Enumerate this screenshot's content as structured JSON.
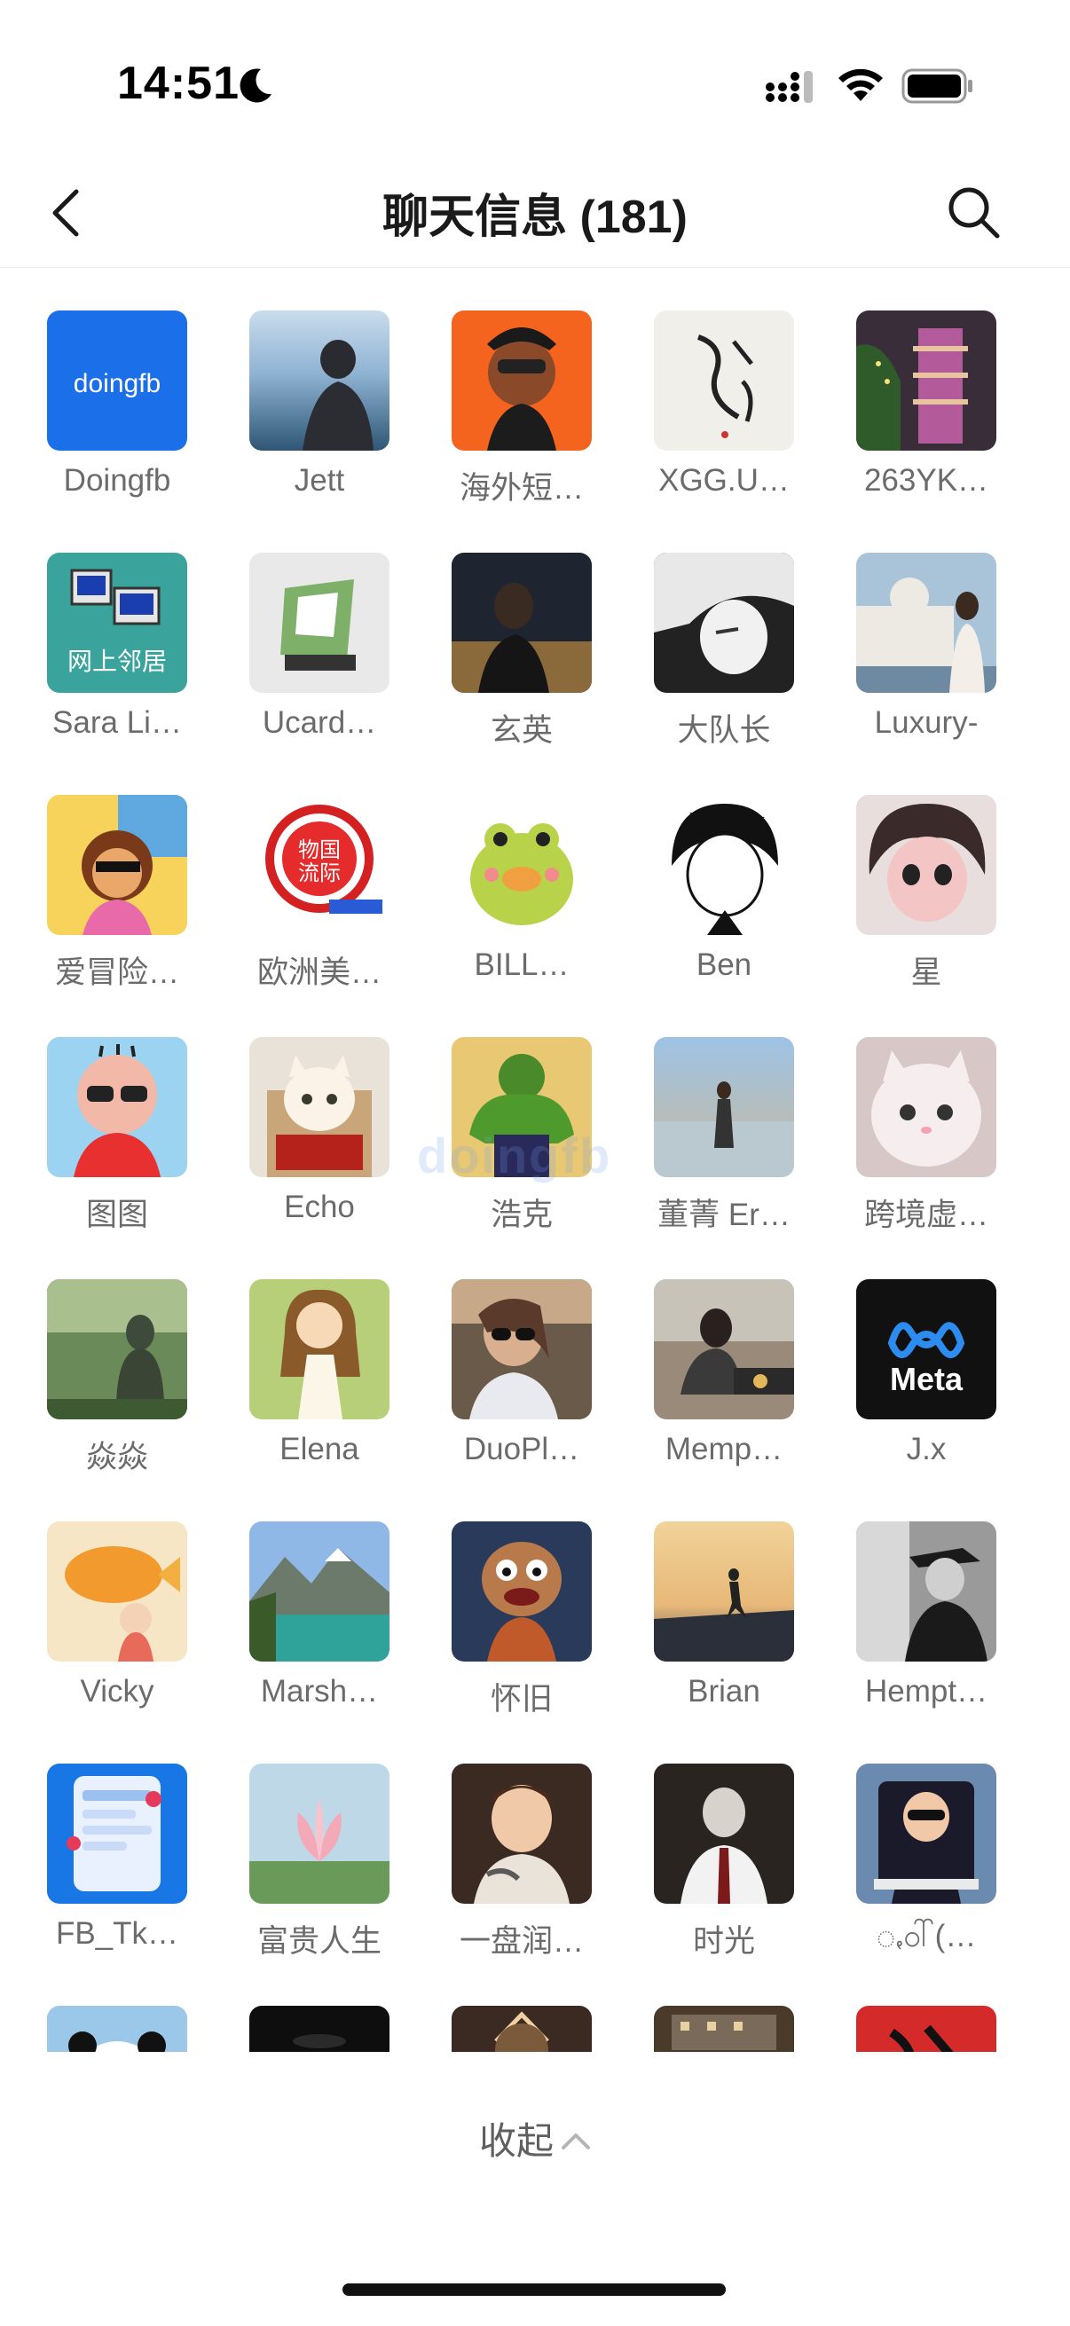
{
  "status_bar": {
    "time": "14:51"
  },
  "nav": {
    "title": "聊天信息 (181)"
  },
  "members": [
    {
      "name": "Doingfb",
      "avatar": "doingfb-logo"
    },
    {
      "name": "Jett",
      "avatar": "person-by-sea-photo"
    },
    {
      "name": "海外短…",
      "avatar": "cartoon-man-orange-photo"
    },
    {
      "name": "XGG.U…",
      "avatar": "calligraphy-photo"
    },
    {
      "name": "263YK…",
      "avatar": "pagoda-night-photo"
    },
    {
      "name": "Sara Li…",
      "avatar": "network-neighborhood-icon"
    },
    {
      "name": "Ucard…",
      "avatar": "ucard-logo"
    },
    {
      "name": "玄英",
      "avatar": "portrait-dark-photo"
    },
    {
      "name": "大队长",
      "avatar": "anime-boy-bw-photo"
    },
    {
      "name": "Luxury-",
      "avatar": "woman-palace-photo"
    },
    {
      "name": "爱冒险…",
      "avatar": "cartoon-girl-photo"
    },
    {
      "name": "欧洲美…",
      "avatar": "logistics-stamp-logo"
    },
    {
      "name": "BILL…",
      "avatar": "green-frog-photo"
    },
    {
      "name": "Ben",
      "avatar": "manga-boy-photo"
    },
    {
      "name": "星",
      "avatar": "anime-boy-pink-photo"
    },
    {
      "name": "图图",
      "avatar": "cartoon-boy-photo"
    },
    {
      "name": "Echo",
      "avatar": "cat-in-box-photo"
    },
    {
      "name": "浩克",
      "avatar": "hulk-photo"
    },
    {
      "name": "董菁 Er…",
      "avatar": "woman-beach-photo"
    },
    {
      "name": "跨境虚…",
      "avatar": "white-kitten-photo"
    },
    {
      "name": "焱焱",
      "avatar": "buddha-forest-photo"
    },
    {
      "name": "Elena",
      "avatar": "cartoon-girl-dress-photo"
    },
    {
      "name": "DuoPl…",
      "avatar": "woman-sunglasses-photo"
    },
    {
      "name": "Memp…",
      "avatar": "woman-cafe-photo"
    },
    {
      "name": "J.x",
      "avatar": "meta-logo"
    },
    {
      "name": "Vicky",
      "avatar": "girl-goldfish-photo"
    },
    {
      "name": "Marsh…",
      "avatar": "mountain-lake-photo"
    },
    {
      "name": "怀旧",
      "avatar": "cartoon-monster-photo"
    },
    {
      "name": "Brian",
      "avatar": "runner-sunset-photo"
    },
    {
      "name": "Hempt…",
      "avatar": "man-hat-bw-photo"
    },
    {
      "name": "FB_Tk…",
      "avatar": "fb-ads-app-icon"
    },
    {
      "name": "富贵人生",
      "avatar": "lotus-photo"
    },
    {
      "name": "一盘润…",
      "avatar": "boy-tattoo-photo"
    },
    {
      "name": "时光",
      "avatar": "boy-suit-photo"
    },
    {
      "name": "ꩻ၀ါ်(…",
      "avatar": "boy-sunglasses-photo"
    },
    {
      "name": "",
      "avatar": "panda-photo"
    },
    {
      "name": "",
      "avatar": "dark-photo"
    },
    {
      "name": "",
      "avatar": "warm-light-photo"
    },
    {
      "name": "",
      "avatar": "building-photo"
    },
    {
      "name": "",
      "avatar": "red-calligraphy-photo"
    }
  ],
  "watermark": "doingfb",
  "collapse": {
    "label": "收起"
  },
  "colors": {
    "accent_blue": "#1a6fe8",
    "text_gray": "#6b6b6b"
  }
}
